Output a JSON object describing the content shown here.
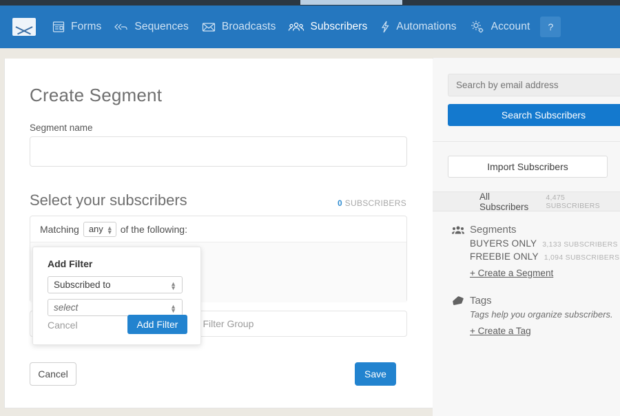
{
  "colors": {
    "nav_bg": "#2577bf",
    "accent_blue": "#2283cf",
    "search_blue": "#1479ce",
    "page_bg": "#ece9e2",
    "sidebar_bg": "#f7f7f7"
  },
  "navbar": {
    "logo_icon": "envelope-logo-icon",
    "items": [
      {
        "label": "Forms",
        "icon": "forms-icon",
        "active": false
      },
      {
        "label": "Sequences",
        "icon": "sequences-icon",
        "active": false
      },
      {
        "label": "Broadcasts",
        "icon": "broadcasts-icon",
        "active": false
      },
      {
        "label": "Subscribers",
        "icon": "subscribers-icon",
        "active": true
      },
      {
        "label": "Automations",
        "icon": "automations-icon",
        "active": false
      },
      {
        "label": "Account",
        "icon": "gear-icon",
        "active": false
      }
    ],
    "help_label": "?"
  },
  "main": {
    "page_title": "Create Segment",
    "segment_name_label": "Segment name",
    "segment_name_value": "",
    "segment_name_placeholder": "",
    "section_title": "Select your subscribers",
    "subscriber_count": "0",
    "subscriber_count_label": "SUBSCRIBERS",
    "matching_prefix": "Matching",
    "matching_value": "any",
    "matching_suffix": "of the following:",
    "add_filter_group_label": "Add Filter Group",
    "cancel_label": "Cancel",
    "save_label": "Save"
  },
  "add_filter_popover": {
    "title": "Add Filter",
    "field_select_value": "Subscribed to",
    "value_select_value": "select",
    "cancel_label": "Cancel",
    "submit_label": "Add Filter"
  },
  "sidebar": {
    "search_placeholder": "Search by email address",
    "search_value": "",
    "search_button_label": "Search Subscribers",
    "import_button_label": "Import Subscribers",
    "all_subscribers": {
      "label": "All Subscribers",
      "count": "4,475 SUBSCRIBERS"
    },
    "segments": {
      "heading": "Segments",
      "icon": "people-icon",
      "items": [
        {
          "name": "BUYERS ONLY",
          "count": "3,133 SUBSCRIBERS"
        },
        {
          "name": "FREEBIE ONLY",
          "count": "1,094 SUBSCRIBERS"
        }
      ],
      "create_link": "+ Create a Segment"
    },
    "tags": {
      "heading": "Tags",
      "icon": "tag-icon",
      "note": "Tags help you organize subscribers.",
      "create_link": "+ Create a Tag"
    }
  }
}
